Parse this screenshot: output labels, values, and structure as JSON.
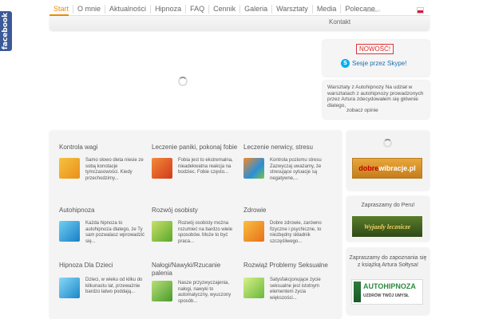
{
  "facebook_tab": "facebook",
  "nav": {
    "items": [
      "Start",
      "O mnie",
      "Aktualności",
      "Hipnoza",
      "FAQ",
      "Cennik",
      "Galeria",
      "Warsztaty",
      "Media",
      "Polecane"
    ],
    "active": "Start",
    "small_link": "KONTAKT",
    "kontakt": "Kontakt"
  },
  "sidebar": {
    "nowosc": "NOWOŚĆ!",
    "skype_text": "Sesje przez Skype!",
    "warsztaty_text": "Warsztaty z Autohipnozy Na udział w warsztatach z autohipnozy prowadzonych przez Artura zdecydowałem się głównie dlatego,",
    "zobacz": "zobacz opinie"
  },
  "grid": [
    {
      "title": "Kontrola wagi",
      "desc": "Samo słowo dieta niesie ze sobą konotacje tymczasowości. Kiedy przechodzimy...",
      "color": "#f2a21d"
    },
    {
      "title": "Leczenie paniki, pokonaj fobie",
      "desc": "Fobia jest to ekstremalna, nieadekwatna reakcja na bodziec. Fobie często...",
      "color": "#e85a2a"
    },
    {
      "title": "Leczenie nerwicy, stresu",
      "desc": "Kontrola poziomu stresu Zazwyczaj uważamy, że stresujące sytuacje są negatywne,...",
      "color": "#2a8fd8"
    },
    {
      "title": "Autohipnoza",
      "desc": "Każda hipnoza to autohipnoza dlatego, że Ty sam pozwalasz wprowadzić się...",
      "color": "#1e9fd8"
    },
    {
      "title": "Rozwój osobisty",
      "desc": "Rozwój osobisty można rozumieć na bardzo wiele sposobów. Może to być praca...",
      "color": "#8ac43f"
    },
    {
      "title": "Zdrowie",
      "desc": "Dobre zdrowie, zarówno fizyczne i psychiczne, to niezbędny składnik szczęśliwego...",
      "color": "#f28a1c"
    },
    {
      "title": "Hipnoza Dla Dzieci",
      "desc": "Dzieci, w wieku od kilku do kilkunastu lat, przeważnie bardzo łatwo poddają...",
      "color": "#27a0d8"
    },
    {
      "title": "Nałogi/Nawyki/Rzucanie palenia",
      "desc": "Nasze przyzwyczajenia, nałogi, nawyki to automatyczny, wyuczony sposób...",
      "color": "#7dbe3a"
    },
    {
      "title": "Rozwiąż Problemy Seksualne",
      "desc": "Satysfakcjonujące życie seksualne jest istotnym elementem życia większości...",
      "color": "#8ed24a"
    }
  ],
  "right": {
    "dobre_brand": "dobre",
    "dobre_rest": "wibracje.pl",
    "peru_caption": "Zapraszamy do Peru!",
    "peru_banner": "Wyjazdy lecznicze",
    "book_caption": "Zapraszamy do zapoznania się z książką Artura Sołtysa!",
    "book_title": "AUTOHIPNOZA",
    "book_subtitle": "UZDRÓW TWÓJ UMYSŁ"
  },
  "colors": {
    "accent": "#f08a00",
    "facebook": "#3b5998",
    "nowosc": "#dd2222"
  }
}
